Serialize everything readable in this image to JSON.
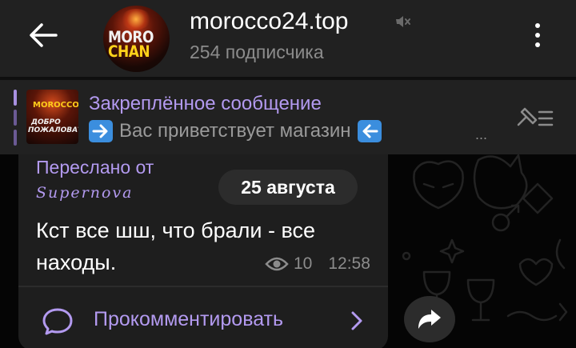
{
  "header": {
    "back_icon": "arrow-left-icon",
    "channel_name": "morocco24.top",
    "avatar_line1": "MORO",
    "avatar_line2": "CHAN",
    "mute_icon": "muted-speaker-icon",
    "subscribers": "254 подписчика",
    "menu_icon": "vertical-dots-icon"
  },
  "pinned": {
    "label": "Закреплённое сообщение",
    "text": "Вас приветствует магазин",
    "thumb_line1": "MOROCCO",
    "thumb_line2": "ДОБРО",
    "thumb_line3": "ПОЖАЛОВАТЬ",
    "ellipsis": "...",
    "left_emoji": "right-arrow-emoji",
    "right_emoji": "left-arrow-emoji",
    "list_icon": "pinned-list-icon"
  },
  "message": {
    "forwarded_label": "Переслано от",
    "forwarded_author": "Supernova",
    "date": "25 августа",
    "text": "Кст все шш, что брали - все находы.",
    "views": "10",
    "time": "12:58",
    "views_icon": "eye-icon",
    "comment_label": "Прокомментировать",
    "comment_icon": "comment-bubble-icon",
    "chevron_icon": "chevron-right-icon",
    "share_icon": "share-arrow-icon"
  },
  "colors": {
    "accent": "#b39af0",
    "header_bg": "#212121",
    "bubble_bg": "#1e1e1e",
    "muted_text": "#8c8c8c"
  }
}
